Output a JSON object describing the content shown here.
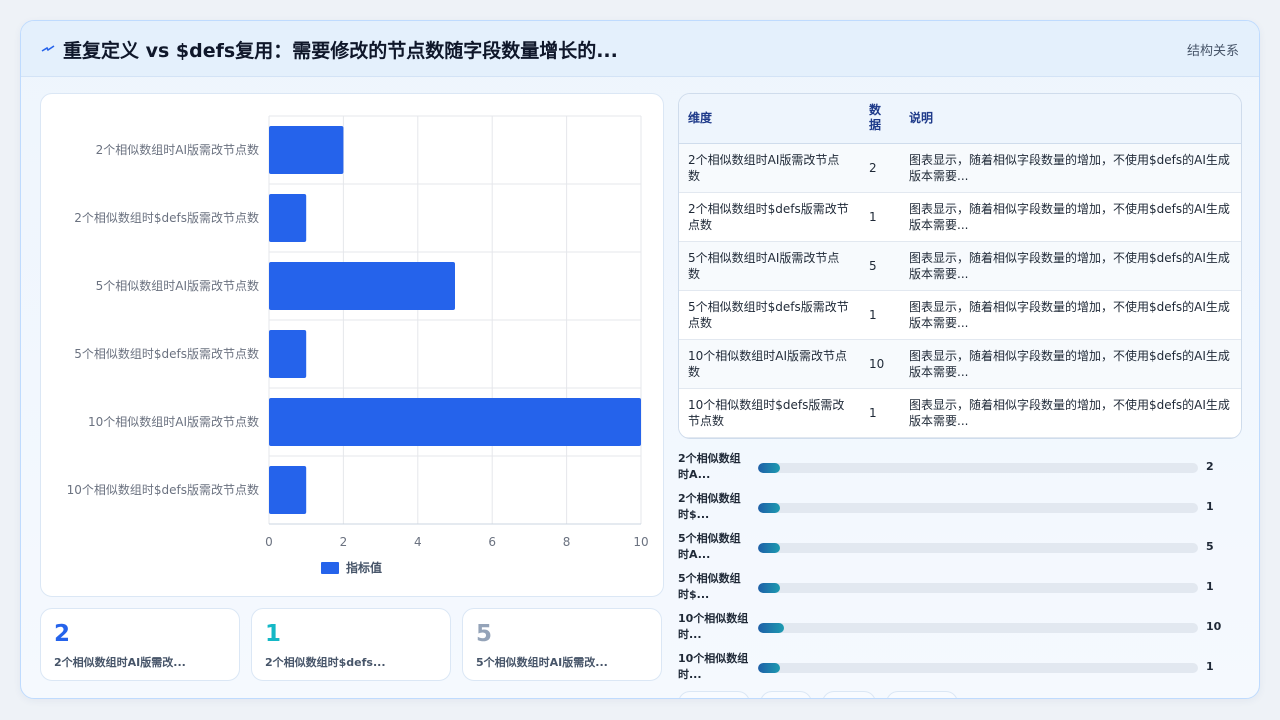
{
  "header": {
    "title": "重复定义 vs $defs复用：需要修改的节点数随字段数量增长的...",
    "tag": "结构关系"
  },
  "chart_data": {
    "type": "bar",
    "orientation": "horizontal",
    "categories": [
      "2个相似数组时AI版需改节点数",
      "2个相似数组时$defs版需改节点数",
      "5个相似数组时AI版需改节点数",
      "5个相似数组时$defs版需改节点数",
      "10个相似数组时AI版需改节点数",
      "10个相似数组时$defs版需改节点数"
    ],
    "series": [
      {
        "name": "指标值",
        "values": [
          2,
          1,
          5,
          1,
          10,
          1
        ]
      }
    ],
    "xlim": [
      0,
      10
    ],
    "xticks": [
      0,
      2,
      4,
      6,
      8,
      10
    ],
    "grid": true,
    "legend": "bottom",
    "colors": {
      "bar": "#2563eb"
    }
  },
  "kpis": [
    {
      "value": "2",
      "label": "2个相似数组时AI版需改...",
      "color": "#2563eb"
    },
    {
      "value": "1",
      "label": "2个相似数组时$defs...",
      "color": "#14b8c6"
    },
    {
      "value": "5",
      "label": "5个相似数组时AI版需改...",
      "color": "#94a3b8"
    }
  ],
  "table": {
    "headers": [
      "维度",
      "数据",
      "说明"
    ],
    "rows": [
      {
        "dim": "2个相似数组时AI版需改节点数",
        "val": "2",
        "desc": "图表显示，随着相似字段数量的增加，不使用$defs的AI生成版本需要..."
      },
      {
        "dim": "2个相似数组时$defs版需改节点数",
        "val": "1",
        "desc": "图表显示，随着相似字段数量的增加，不使用$defs的AI生成版本需要..."
      },
      {
        "dim": "5个相似数组时AI版需改节点数",
        "val": "5",
        "desc": "图表显示，随着相似字段数量的增加，不使用$defs的AI生成版本需要..."
      },
      {
        "dim": "5个相似数组时$defs版需改节点数",
        "val": "1",
        "desc": "图表显示，随着相似字段数量的增加，不使用$defs的AI生成版本需要..."
      },
      {
        "dim": "10个相似数组时AI版需改节点数",
        "val": "10",
        "desc": "图表显示，随着相似字段数量的增加，不使用$defs的AI生成版本需要..."
      },
      {
        "dim": "10个相似数组时$defs版需改节点数",
        "val": "1",
        "desc": "图表显示，随着相似字段数量的增加，不使用$defs的AI生成版本需要..."
      }
    ]
  },
  "progress": [
    {
      "label": "2个相似数组时A...",
      "value": "2",
      "fraction": 0.05
    },
    {
      "label": "2个相似数组时$...",
      "value": "1",
      "fraction": 0.05
    },
    {
      "label": "5个相似数组时A...",
      "value": "5",
      "fraction": 0.05
    },
    {
      "label": "5个相似数组时$...",
      "value": "1",
      "fraction": 0.05
    },
    {
      "label": "10个相似数组时...",
      "value": "10",
      "fraction": 0.06
    },
    {
      "label": "10个相似数组时...",
      "value": "1",
      "fraction": 0.05
    }
  ]
}
